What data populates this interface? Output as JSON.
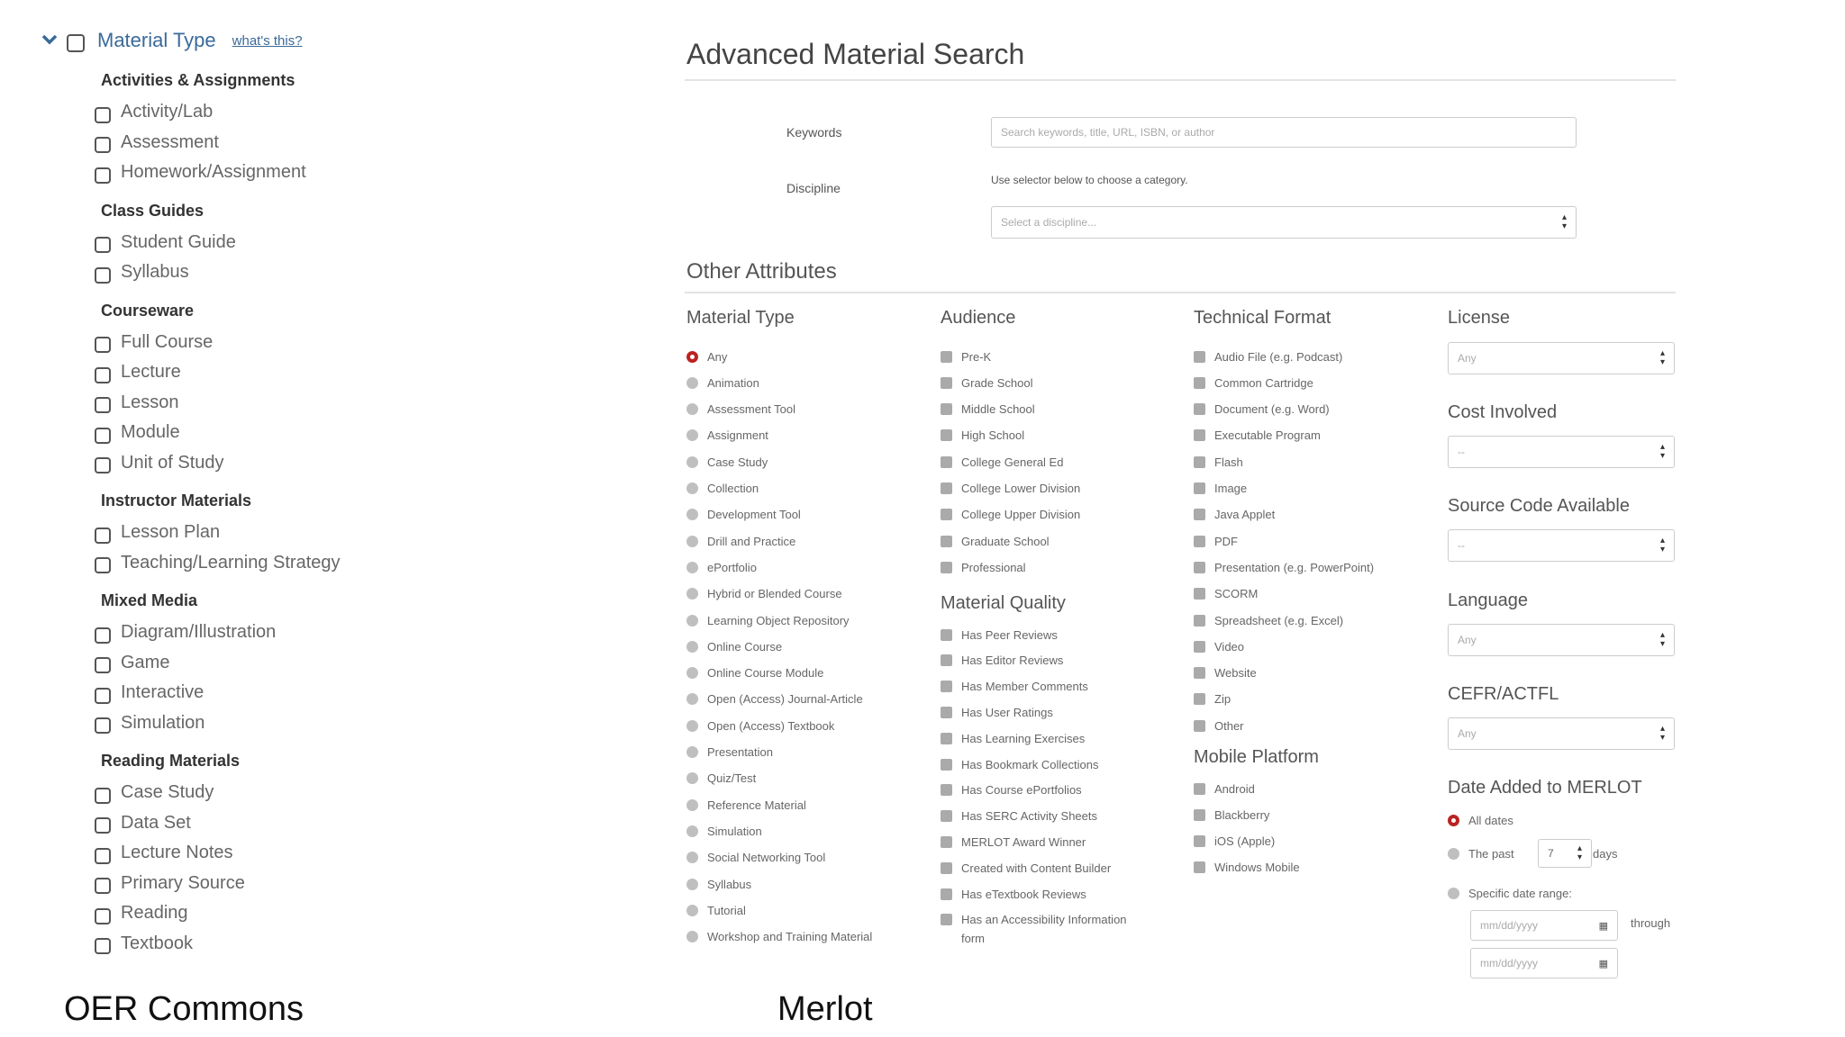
{
  "oer": {
    "title": "Material Type",
    "whats_this": "what's this?",
    "caption": "OER Commons",
    "groups": [
      {
        "title": "Activities & Assignments",
        "items": [
          "Activity/Lab",
          "Assessment",
          "Homework/Assignment"
        ]
      },
      {
        "title": "Class Guides",
        "items": [
          "Student Guide",
          "Syllabus"
        ]
      },
      {
        "title": "Courseware",
        "items": [
          "Full Course",
          "Lecture",
          "Lesson",
          "Module",
          "Unit of Study"
        ]
      },
      {
        "title": "Instructor Materials",
        "items": [
          "Lesson Plan",
          "Teaching/Learning Strategy"
        ]
      },
      {
        "title": "Mixed Media",
        "items": [
          "Diagram/Illustration",
          "Game",
          "Interactive",
          "Simulation"
        ]
      },
      {
        "title": "Reading Materials",
        "items": [
          "Case Study",
          "Data Set",
          "Lecture Notes",
          "Primary Source",
          "Reading",
          "Textbook"
        ]
      }
    ]
  },
  "merlot": {
    "caption": "Merlot",
    "title": "Advanced Material Search",
    "keywords_label": "Keywords",
    "keywords_placeholder": "Search keywords, title, URL, ISBN, or author",
    "discipline_label": "Discipline",
    "discipline_note": "Use selector below to choose a category.",
    "discipline_select": "Select a discipline...",
    "other_attributes": "Other Attributes",
    "material_type": {
      "title": "Material Type",
      "selected": "Any",
      "options": [
        "Any",
        "Animation",
        "Assessment Tool",
        "Assignment",
        "Case Study",
        "Collection",
        "Development Tool",
        "Drill and Practice",
        "ePortfolio",
        "Hybrid or Blended Course",
        "Learning Object Repository",
        "Online Course",
        "Online Course Module",
        "Open (Access) Journal-Article",
        "Open (Access) Textbook",
        "Presentation",
        "Quiz/Test",
        "Reference Material",
        "Simulation",
        "Social Networking Tool",
        "Syllabus",
        "Tutorial",
        "Workshop and Training Material"
      ]
    },
    "audience": {
      "title": "Audience",
      "options": [
        "Pre-K",
        "Grade School",
        "Middle School",
        "High School",
        "College General Ed",
        "College Lower Division",
        "College Upper Division",
        "Graduate School",
        "Professional"
      ]
    },
    "material_quality": {
      "title": "Material Quality",
      "options": [
        "Has Peer Reviews",
        "Has Editor Reviews",
        "Has Member Comments",
        "Has User Ratings",
        "Has Learning Exercises",
        "Has Bookmark Collections",
        "Has Course ePortfolios",
        "Has SERC Activity Sheets",
        "MERLOT Award Winner",
        "Created with Content Builder",
        "Has eTextbook Reviews",
        "Has an Accessibility Information",
        "form"
      ]
    },
    "technical_format": {
      "title": "Technical Format",
      "options": [
        "Audio File (e.g. Podcast)",
        "Common Cartridge",
        "Document (e.g. Word)",
        "Executable Program",
        "Flash",
        "Image",
        "Java Applet",
        "PDF",
        "Presentation (e.g. PowerPoint)",
        "SCORM",
        "Spreadsheet (e.g. Excel)",
        "Video",
        "Website",
        "Zip",
        "Other"
      ]
    },
    "mobile_platform": {
      "title": "Mobile Platform",
      "options": [
        "Android",
        "Blackberry",
        "iOS (Apple)",
        "Windows Mobile"
      ]
    },
    "license": {
      "title": "License",
      "value": "Any"
    },
    "cost": {
      "title": "Cost Involved",
      "value": "--"
    },
    "source_code": {
      "title": "Source Code Available",
      "value": "--"
    },
    "language": {
      "title": "Language",
      "value": "Any"
    },
    "cefr": {
      "title": "CEFR/ACTFL",
      "value": "Any"
    },
    "date_added": {
      "title": "Date Added to MERLOT",
      "all_dates": "All dates",
      "the_past": "The past",
      "past_value": "7",
      "days": "days",
      "specific": "Specific date range:",
      "date_placeholder": "mm/dd/yyyy",
      "through": "through"
    }
  }
}
